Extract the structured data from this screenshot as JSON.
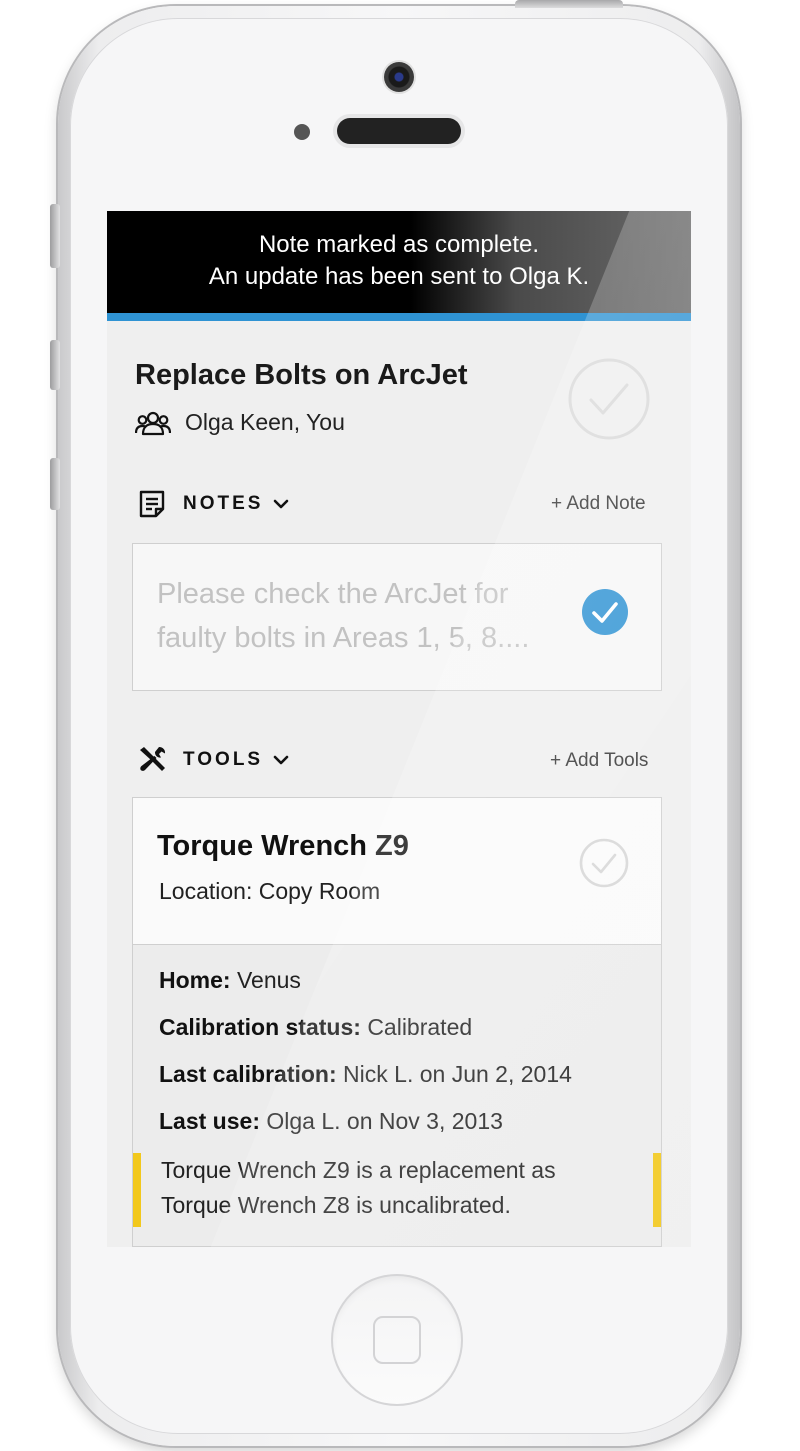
{
  "toast": {
    "line1": "Note marked as complete.",
    "line2": "An update has been sent to Olga K."
  },
  "task": {
    "title": "Replace Bolts on ArcJet",
    "assignees": "Olga Keen, You",
    "completed": false
  },
  "notes": {
    "header": "NOTES",
    "add_label": "+ Add Note",
    "items": [
      {
        "text": "Please check the ArcJet for faulty bolts in Areas 1, 5, 8....",
        "completed": true
      }
    ]
  },
  "tools": {
    "header": "TOOLS",
    "add_label": "+ Add Tools",
    "items": [
      {
        "name": "Torque Wrench Z9",
        "location": "Location: Copy Room",
        "completed": false,
        "details": [
          {
            "label": "Home:",
            "value": "Venus"
          },
          {
            "label": "Calibration status:",
            "value": "Calibrated"
          },
          {
            "label": "Last calibration:",
            "value": "Nick L. on Jun 2, 2014"
          },
          {
            "label": "Last use:",
            "value": "Olga L. on Nov 3, 2013"
          }
        ],
        "callout_line1": "Torque Wrench Z9 is a replacement as",
        "callout_line2": "Torque Wrench Z8 is uncalibrated."
      }
    ]
  },
  "colors": {
    "accent_blue": "#2f93d3",
    "callout_yellow": "#f2c81c",
    "toast_bg": "#000000"
  },
  "icons": {
    "assignees": "group-people-icon",
    "notes": "note-document-icon",
    "tools": "wrench-screwdriver-icon",
    "expand": "chevron-down-icon",
    "complete": "checkmark-circle-icon"
  }
}
